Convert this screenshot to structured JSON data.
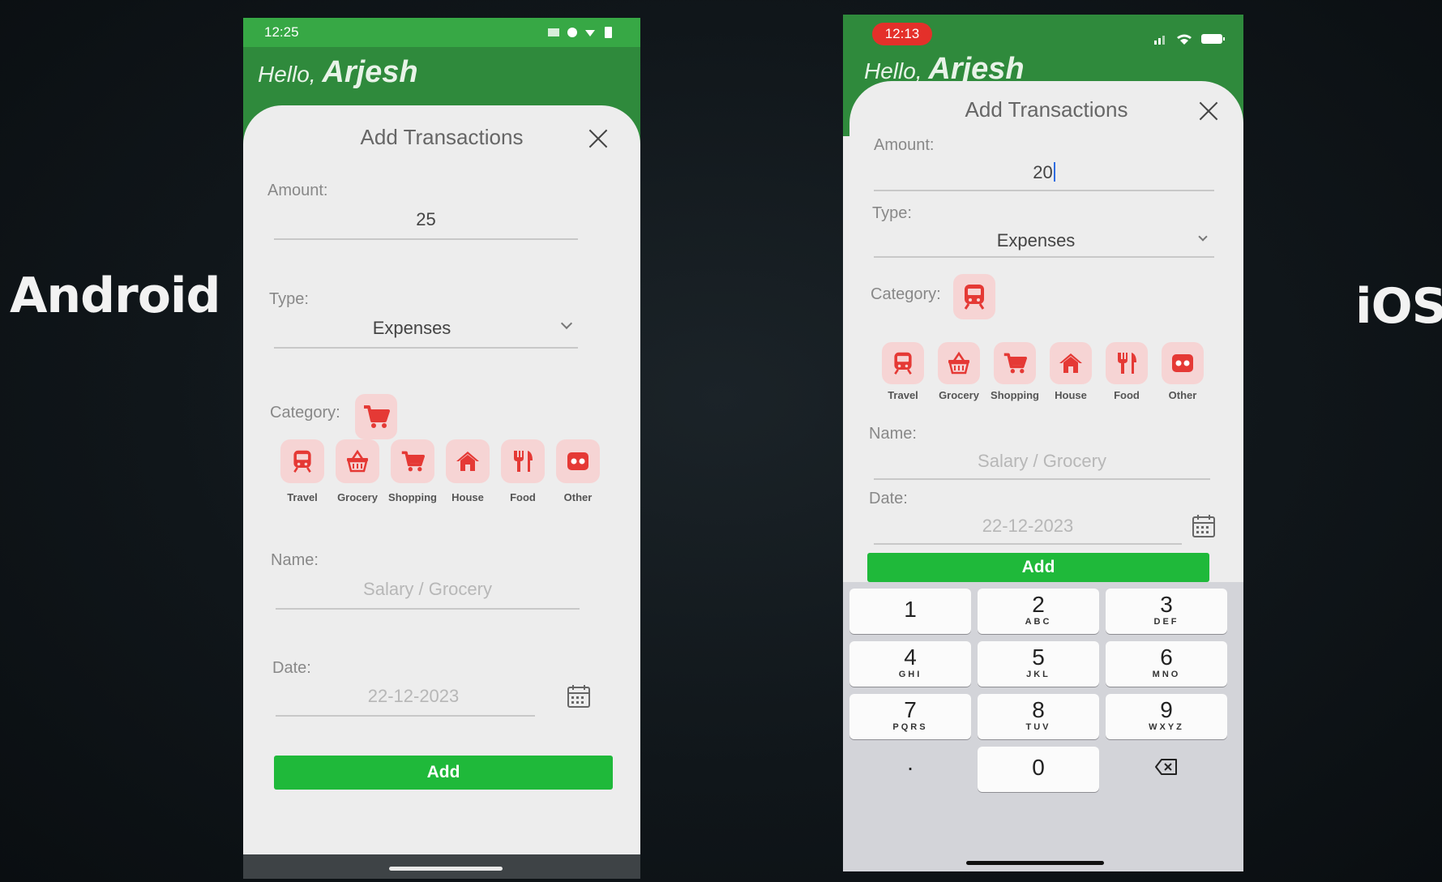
{
  "labels": {
    "android": "Android",
    "ios": "iOS"
  },
  "categories": [
    {
      "name": "Travel",
      "icon": "train-icon"
    },
    {
      "name": "Grocery",
      "icon": "basket-icon"
    },
    {
      "name": "Shopping",
      "icon": "cart-icon"
    },
    {
      "name": "House",
      "icon": "house-icon"
    },
    {
      "name": "Food",
      "icon": "fork-knife-icon"
    },
    {
      "name": "Other",
      "icon": "other-icon"
    }
  ],
  "android": {
    "time": "12:25",
    "greeting": {
      "hello": "Hello,",
      "name": "Arjesh"
    },
    "title": "Add Transactions",
    "amount_label": "Amount:",
    "amount_value": "25",
    "type_label": "Type:",
    "type_value": "Expenses",
    "category_label": "Category:",
    "selected_category_icon": "cart-icon",
    "name_label": "Name:",
    "name_placeholder": "Salary / Grocery",
    "date_label": "Date:",
    "date_placeholder": "22-12-2023",
    "add_label": "Add"
  },
  "ios": {
    "time": "12:13",
    "greeting": {
      "hello": "Hello,",
      "name": "Arjesh"
    },
    "title": "Add Transactions",
    "amount_label": "Amount:",
    "amount_value": "20",
    "type_label": "Type:",
    "type_value": "Expenses",
    "category_label": "Category:",
    "selected_category_icon": "train-icon",
    "name_label": "Name:",
    "name_placeholder": "Salary / Grocery",
    "date_label": "Date:",
    "date_placeholder": "22-12-2023",
    "add_label": "Add",
    "keypad": [
      {
        "digit": "1",
        "letters": ""
      },
      {
        "digit": "2",
        "letters": "ABC"
      },
      {
        "digit": "3",
        "letters": "DEF"
      },
      {
        "digit": "4",
        "letters": "GHI"
      },
      {
        "digit": "5",
        "letters": "JKL"
      },
      {
        "digit": "6",
        "letters": "MNO"
      },
      {
        "digit": "7",
        "letters": "PQRS"
      },
      {
        "digit": "8",
        "letters": "TUV"
      },
      {
        "digit": "9",
        "letters": "WXYZ"
      },
      {
        "digit": "0",
        "letters": ""
      }
    ],
    "keypad_dot": "."
  },
  "colors": {
    "header_green": "#2f8a3c",
    "button_green": "#1fb93a",
    "category_red": "#e53935",
    "category_tile": "#f6d4d4"
  }
}
